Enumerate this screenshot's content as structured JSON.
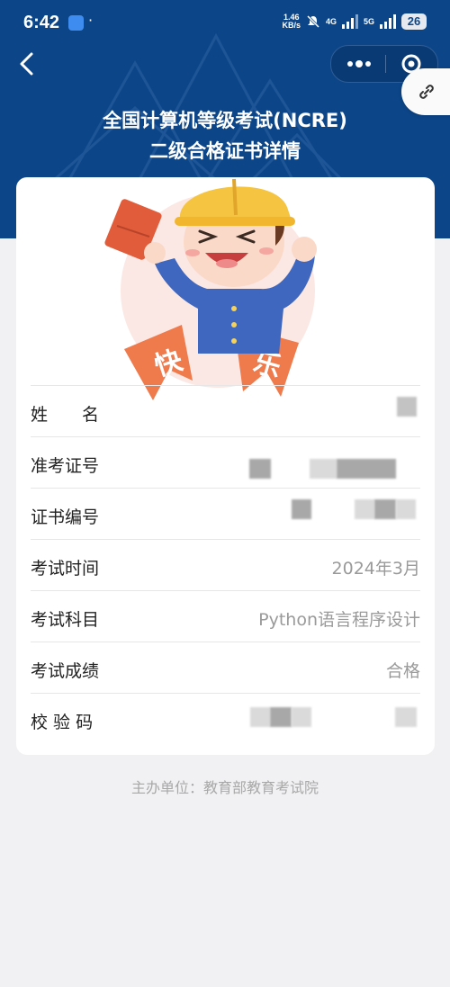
{
  "status_bar": {
    "time": "6:42",
    "dot": "·",
    "net_speed_value": "1.46",
    "net_speed_unit": "KB/s",
    "signal_4g": "4G",
    "signal_5g": "5G",
    "battery": "26",
    "icons": [
      "app-notification-icon",
      "mute-icon",
      "signal-icon",
      "battery-icon"
    ]
  },
  "nav": {
    "back_icon": "chevron-left-icon",
    "more_icon": "more-dots-icon",
    "target_icon": "target-icon",
    "share_icon": "link-icon"
  },
  "header": {
    "title_line1": "全国计算机等级考试(NCRE)",
    "title_line2": "二级合格证书详情",
    "bg_color": "#0c4689"
  },
  "sticker": {
    "ribbon_left": "快",
    "ribbon_right": "乐"
  },
  "details": [
    {
      "label": "姓　　名",
      "value": ""
    },
    {
      "label": "准考证号",
      "value": ""
    },
    {
      "label": "证书编号",
      "value": ""
    },
    {
      "label": "考试时间",
      "value": "2024年3月"
    },
    {
      "label": "考试科目",
      "value": "Python语言程序设计"
    },
    {
      "label": "考试成绩",
      "value": "合格"
    },
    {
      "label": "校 验 码",
      "value": ""
    }
  ],
  "footer": {
    "text": "主办单位：教育部教育考试院"
  }
}
